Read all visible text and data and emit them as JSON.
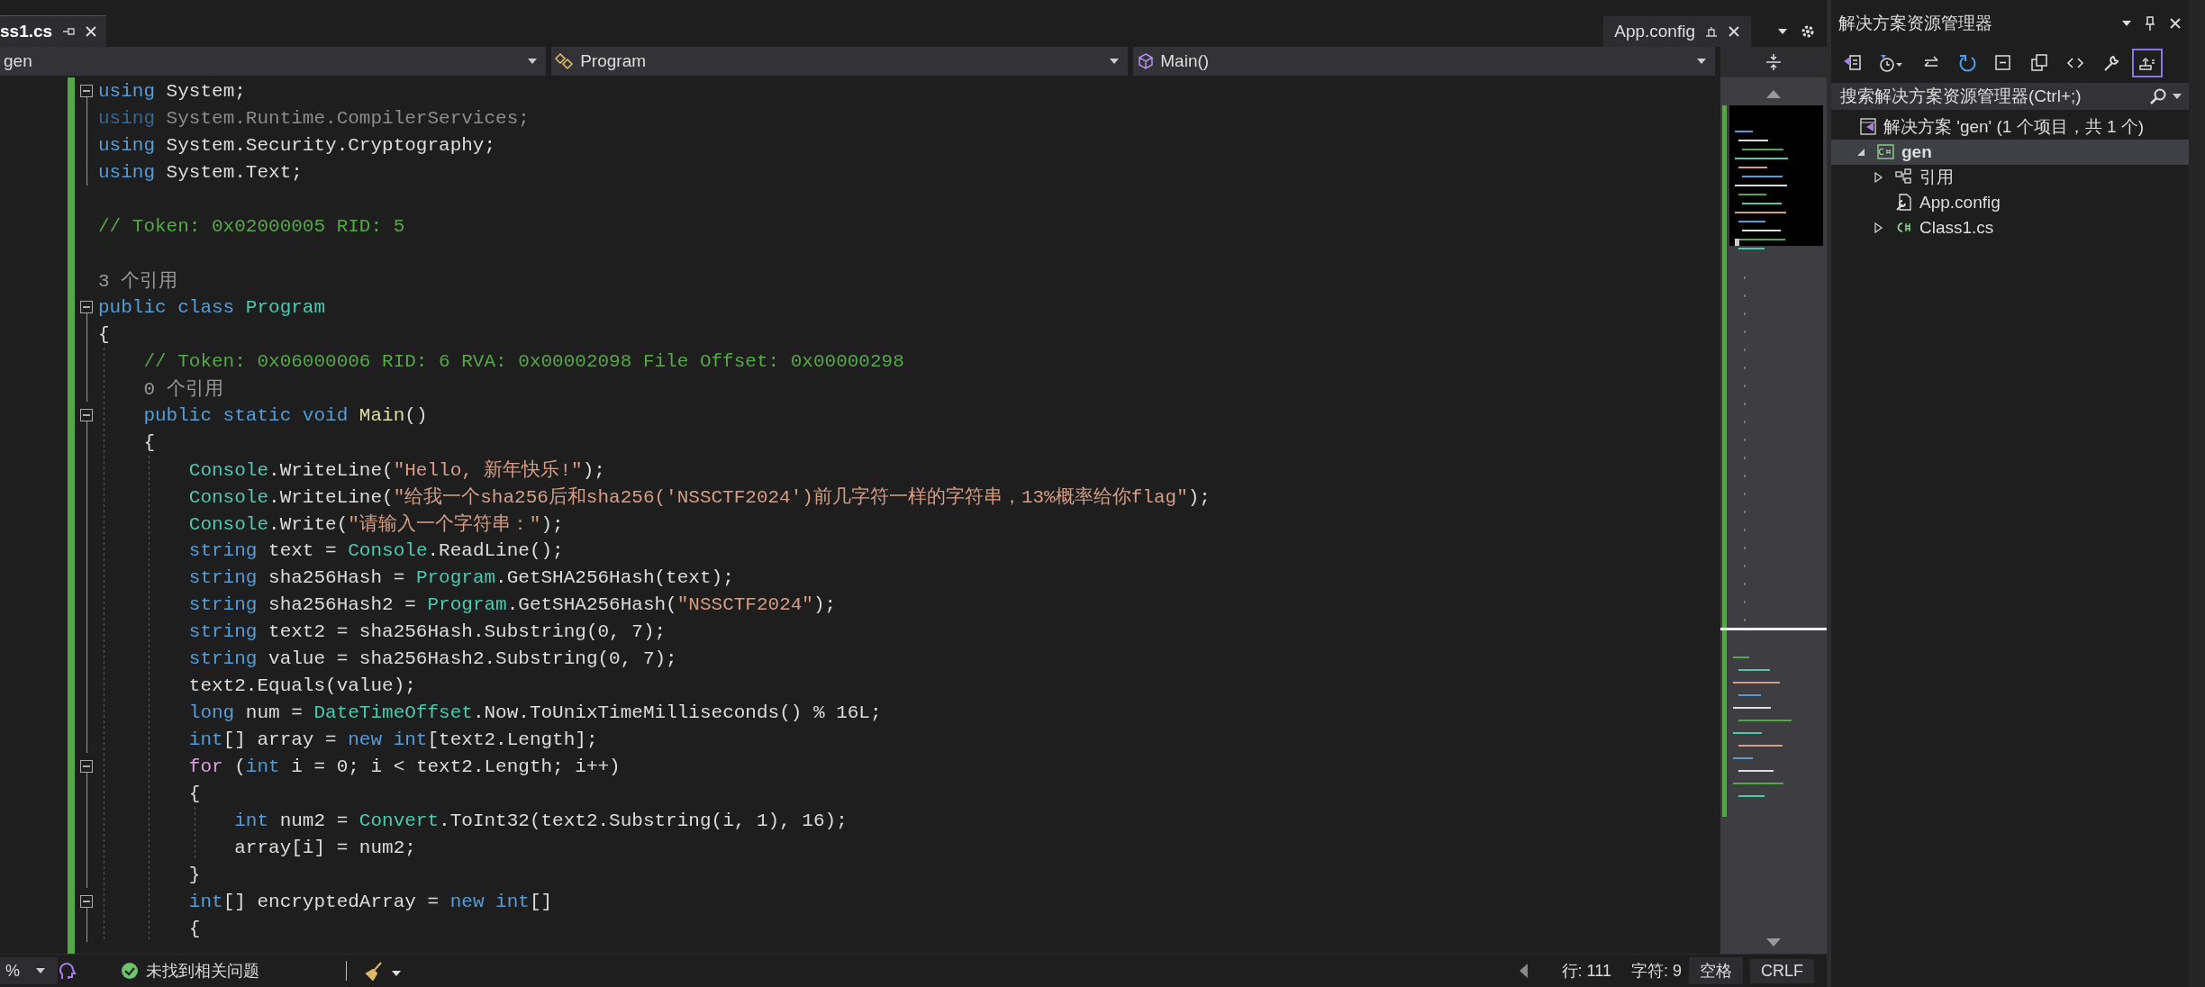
{
  "tabs": [
    {
      "label": "ss1.cs",
      "selected": true
    }
  ],
  "right_tabs": [
    {
      "label": "App.config",
      "selected": false
    }
  ],
  "navigation": [
    {
      "label": "gen",
      "kind": "project"
    },
    {
      "label": "Program",
      "kind": "class"
    },
    {
      "label": "Main()",
      "kind": "method"
    }
  ],
  "code": [
    {
      "kind": "code",
      "fold": true,
      "tokens": [
        {
          "kind": "keyword",
          "text": "using"
        },
        {
          "kind": "plain",
          "text": " System;"
        }
      ]
    },
    {
      "kind": "code",
      "fold": false,
      "tokens": [
        {
          "kind": "dim-keyword",
          "text": "using"
        },
        {
          "kind": "dim",
          "text": " System.Runtime.CompilerServices;"
        }
      ]
    },
    {
      "kind": "code",
      "fold": false,
      "tokens": [
        {
          "kind": "keyword",
          "text": "using"
        },
        {
          "kind": "plain",
          "text": " System.Security.Cryptography;"
        }
      ]
    },
    {
      "kind": "code",
      "fold": false,
      "tokens": [
        {
          "kind": "keyword",
          "text": "using"
        },
        {
          "kind": "plain",
          "text": " System.Text;"
        }
      ]
    },
    {
      "kind": "blank"
    },
    {
      "kind": "code",
      "fold": false,
      "tokens": [
        {
          "kind": "comment",
          "text": "// Token: 0x02000005 RID: 5"
        }
      ]
    },
    {
      "kind": "blank"
    },
    {
      "kind": "codelens",
      "text": "3 个引用"
    },
    {
      "kind": "code",
      "fold": true,
      "tokens": [
        {
          "kind": "keyword",
          "text": "public class "
        },
        {
          "kind": "type",
          "text": "Program"
        }
      ]
    },
    {
      "kind": "code",
      "fold": false,
      "tokens": [
        {
          "kind": "plain",
          "text": "{"
        }
      ],
      "children": [
        {
          "kind": "code",
          "fold": false,
          "tokens": [
            {
              "kind": "comment",
              "text": "// Token: 0x06000006 RID: 6 RVA: 0x00002098 File Offset: 0x00000298"
            }
          ]
        },
        {
          "kind": "codelens",
          "text": "0 个引用"
        },
        {
          "kind": "code",
          "fold": true,
          "tokens": [
            {
              "kind": "keyword",
              "text": "public static void "
            },
            {
              "kind": "method",
              "text": "Main"
            },
            {
              "kind": "plain",
              "text": "()"
            }
          ]
        },
        {
          "kind": "code",
          "fold": false,
          "tokens": [
            {
              "kind": "plain",
              "text": "{"
            }
          ],
          "children": [
            {
              "kind": "code",
              "fold": false,
              "tokens": [
                {
                  "kind": "type",
                  "text": "Console"
                },
                {
                  "kind": "plain",
                  "text": ".WriteLine("
                },
                {
                  "kind": "string",
                  "text": "\"Hello, 新年快乐!\""
                },
                {
                  "kind": "plain",
                  "text": ");"
                }
              ]
            },
            {
              "kind": "code",
              "fold": false,
              "tokens": [
                {
                  "kind": "type",
                  "text": "Console"
                },
                {
                  "kind": "plain",
                  "text": ".WriteLine("
                },
                {
                  "kind": "string",
                  "text": "\"给我一个sha256后和sha256('NSSCTF2024')前几字符一样的字符串，13%概率给你flag\""
                },
                {
                  "kind": "plain",
                  "text": ");"
                }
              ]
            },
            {
              "kind": "code",
              "fold": false,
              "tokens": [
                {
                  "kind": "type",
                  "text": "Console"
                },
                {
                  "kind": "plain",
                  "text": ".Write("
                },
                {
                  "kind": "string",
                  "text": "\"请输入一个字符串：\""
                },
                {
                  "kind": "plain",
                  "text": ");"
                }
              ]
            },
            {
              "kind": "code",
              "fold": false,
              "tokens": [
                {
                  "kind": "keyword",
                  "text": "string"
                },
                {
                  "kind": "plain",
                  "text": " text = "
                },
                {
                  "kind": "type",
                  "text": "Console"
                },
                {
                  "kind": "plain",
                  "text": ".ReadLine();"
                }
              ]
            },
            {
              "kind": "code",
              "fold": false,
              "tokens": [
                {
                  "kind": "keyword",
                  "text": "string"
                },
                {
                  "kind": "plain",
                  "text": " sha256Hash = "
                },
                {
                  "kind": "type",
                  "text": "Program"
                },
                {
                  "kind": "plain",
                  "text": ".GetSHA256Hash(text);"
                }
              ]
            },
            {
              "kind": "code",
              "fold": false,
              "tokens": [
                {
                  "kind": "keyword",
                  "text": "string"
                },
                {
                  "kind": "plain",
                  "text": " sha256Hash2 = "
                },
                {
                  "kind": "type",
                  "text": "Program"
                },
                {
                  "kind": "plain",
                  "text": ".GetSHA256Hash("
                },
                {
                  "kind": "string",
                  "text": "\"NSSCTF2024\""
                },
                {
                  "kind": "plain",
                  "text": ");"
                }
              ]
            },
            {
              "kind": "code",
              "fold": false,
              "tokens": [
                {
                  "kind": "keyword",
                  "text": "string"
                },
                {
                  "kind": "plain",
                  "text": " text2 = sha256Hash.Substring(0, 7);"
                }
              ]
            },
            {
              "kind": "code",
              "fold": false,
              "tokens": [
                {
                  "kind": "keyword",
                  "text": "string"
                },
                {
                  "kind": "plain",
                  "text": " value = sha256Hash2.Substring(0, 7);"
                }
              ]
            },
            {
              "kind": "code",
              "fold": false,
              "tokens": [
                {
                  "kind": "plain",
                  "text": "text2.Equals(value);"
                }
              ]
            },
            {
              "kind": "code",
              "fold": false,
              "tokens": [
                {
                  "kind": "keyword",
                  "text": "long"
                },
                {
                  "kind": "plain",
                  "text": " num = "
                },
                {
                  "kind": "type",
                  "text": "DateTimeOffset"
                },
                {
                  "kind": "plain",
                  "text": ".Now.ToUnixTimeMilliseconds() % 16L;"
                }
              ]
            },
            {
              "kind": "code",
              "fold": false,
              "tokens": [
                {
                  "kind": "keyword",
                  "text": "int"
                },
                {
                  "kind": "plain",
                  "text": "[] array = "
                },
                {
                  "kind": "keyword",
                  "text": "new int"
                },
                {
                  "kind": "plain",
                  "text": "[text2.Length];"
                }
              ]
            },
            {
              "kind": "code",
              "fold": true,
              "tokens": [
                {
                  "kind": "control",
                  "text": "for"
                },
                {
                  "kind": "plain",
                  "text": " ("
                },
                {
                  "kind": "keyword",
                  "text": "int"
                },
                {
                  "kind": "plain",
                  "text": " i = 0; i < text2.Length; i++)"
                }
              ]
            },
            {
              "kind": "code",
              "fold": false,
              "tokens": [
                {
                  "kind": "plain",
                  "text": "{"
                }
              ],
              "children": [
                {
                  "kind": "code",
                  "fold": false,
                  "tokens": [
                    {
                      "kind": "keyword",
                      "text": "int"
                    },
                    {
                      "kind": "plain",
                      "text": " num2 = "
                    },
                    {
                      "kind": "type",
                      "text": "Convert"
                    },
                    {
                      "kind": "plain",
                      "text": ".ToInt32(text2.Substring(i, 1), 16);"
                    }
                  ]
                },
                {
                  "kind": "code",
                  "fold": false,
                  "tokens": [
                    {
                      "kind": "plain",
                      "text": "array[i] = num2;"
                    }
                  ]
                }
              ]
            },
            {
              "kind": "code",
              "fold": false,
              "tokens": [
                {
                  "kind": "plain",
                  "text": "}"
                }
              ]
            },
            {
              "kind": "code",
              "fold": true,
              "tokens": [
                {
                  "kind": "keyword",
                  "text": "int"
                },
                {
                  "kind": "plain",
                  "text": "[] encryptedArray = "
                },
                {
                  "kind": "keyword",
                  "text": "new int"
                },
                {
                  "kind": "plain",
                  "text": "[]"
                }
              ]
            },
            {
              "kind": "code",
              "fold": false,
              "tokens": [
                {
                  "kind": "plain",
                  "text": "{"
                }
              ]
            }
          ]
        }
      ]
    }
  ],
  "status_bar": {
    "zoom": "%",
    "issues": "未找到相关问题",
    "line": "行: 111",
    "column": "字符: 9",
    "indent": "空格",
    "line_ending": "CRLF"
  },
  "explorer": {
    "title": "解决方案资源管理器",
    "toolbar": [
      {
        "selected": false
      },
      {
        "selected": false
      },
      {
        "selected": false
      },
      {
        "selected": false
      },
      {
        "selected": false
      },
      {
        "selected": false
      },
      {
        "selected": false
      },
      {
        "selected": false
      },
      {
        "selected": true
      }
    ],
    "search": {
      "placeholder": "搜索解决方案资源管理器(Ctrl+;)"
    },
    "tree": [
      {
        "label": "解决方案 'gen' (1 个项目，共 1 个)",
        "kind": "solution",
        "selected": false,
        "children": [
          {
            "label": "gen",
            "kind": "project",
            "expanded": true,
            "selected": true,
            "children": [
              {
                "label": "引用",
                "kind": "references",
                "expanded": false,
                "selected": false
              },
              {
                "label": "App.config",
                "kind": "config",
                "selected": false
              },
              {
                "label": "Class1.cs",
                "kind": "csharp",
                "expanded": false,
                "selected": false
              }
            ]
          }
        ]
      }
    ]
  }
}
